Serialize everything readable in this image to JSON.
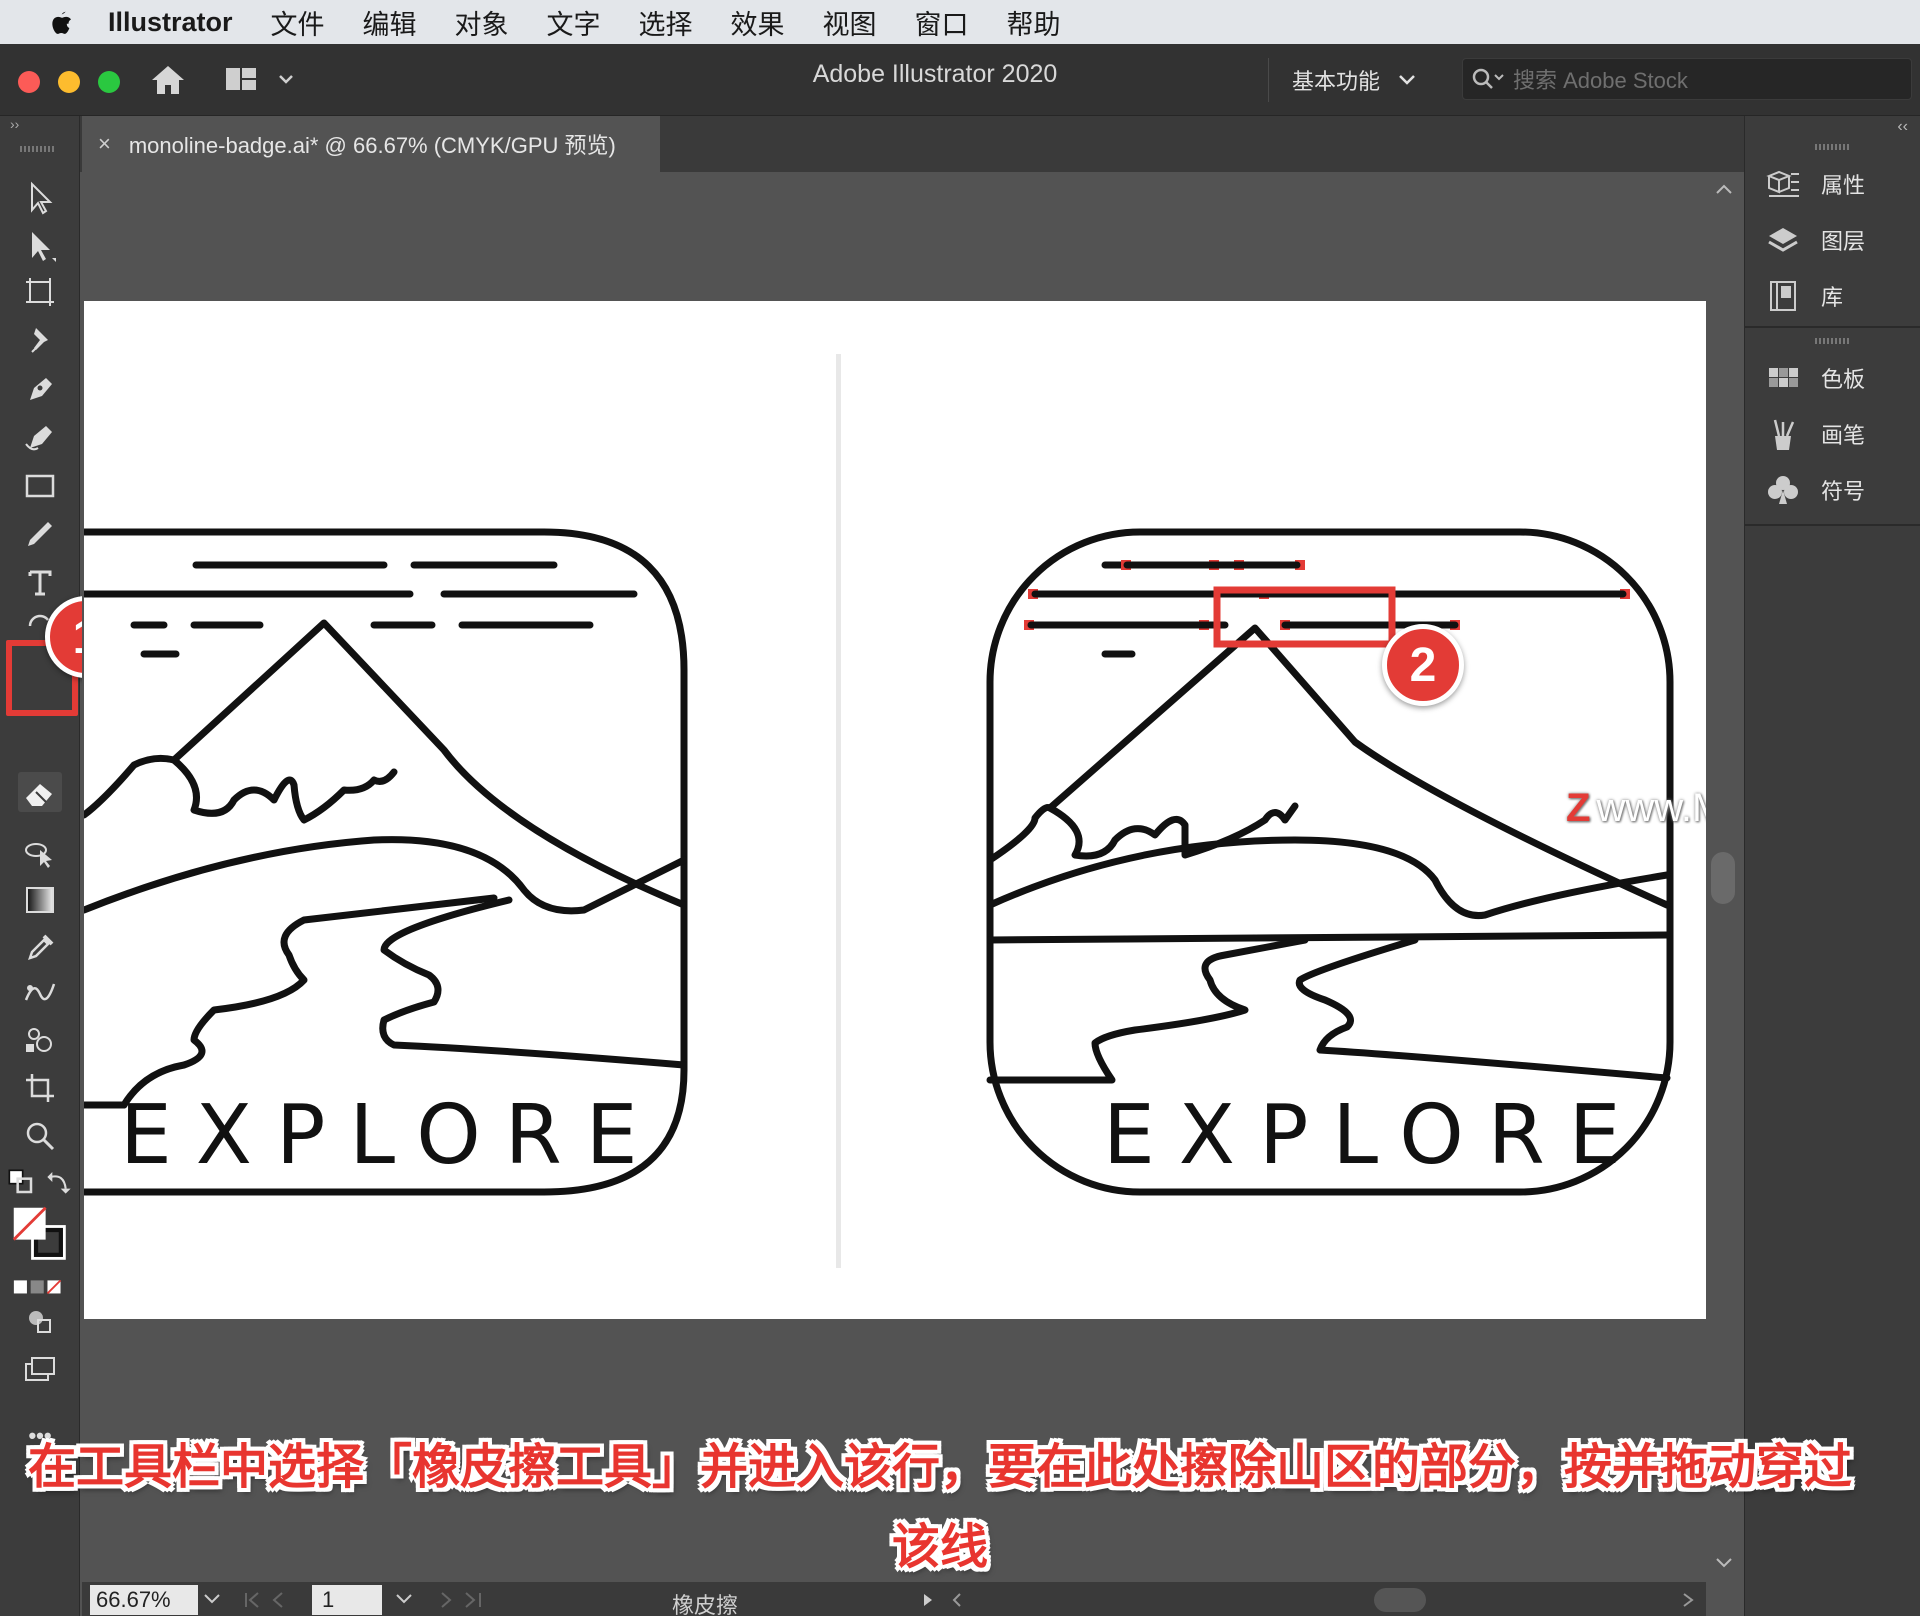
{
  "menubar": {
    "app_name": "Illustrator",
    "items": [
      "文件",
      "编辑",
      "对象",
      "文字",
      "选择",
      "效果",
      "视图",
      "窗口",
      "帮助"
    ]
  },
  "appbar": {
    "title": "Adobe Illustrator 2020",
    "workspace": "基本功能",
    "search_placeholder": "搜索 Adobe Stock"
  },
  "document": {
    "tab_label": "monoline-badge.ai* @ 66.67% (CMYK/GPU 预览)",
    "close": "×"
  },
  "toolbar": {
    "collapse": "››",
    "more": "•••"
  },
  "artwork": {
    "left_label": "EXPLORE",
    "right_label": "EXPLORE",
    "watermark": "www.MacZ.com",
    "watermark_mark": "Z"
  },
  "annotations": {
    "step1": "1",
    "step2": "2",
    "caption_line1": "在工具栏中选择「橡皮擦工具」并进入该行，要在此处擦除山区的部分，按并拖动穿过",
    "caption_line2": "该线"
  },
  "right_panel": {
    "collapse": "‹‹",
    "group1": [
      "属性",
      "图层",
      "库"
    ],
    "group2": [
      "色板",
      "画笔",
      "符号"
    ]
  },
  "statusbar": {
    "zoom": "66.67%",
    "page": "1",
    "current_tool": "橡皮擦"
  },
  "colors": {
    "accent_red": "#e33b36",
    "panel_bg": "#3c3c3c",
    "canvas_bg": "#535353"
  }
}
